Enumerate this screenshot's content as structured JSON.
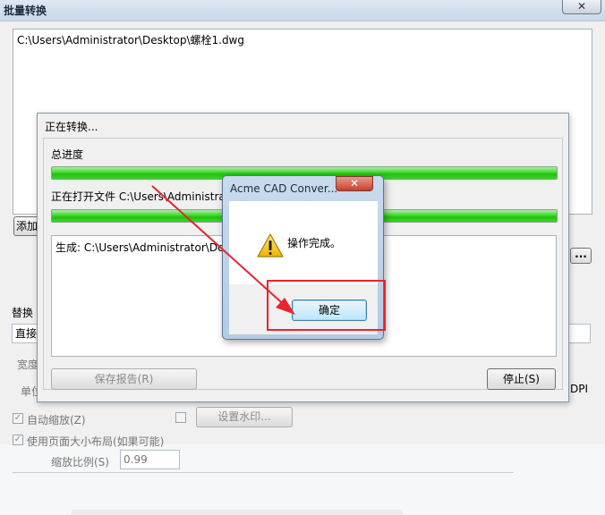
{
  "main": {
    "title": "批量转换",
    "close_glyph": "✕",
    "file_list": [
      "C:\\Users\\Administrator\\Desktop\\螺栓1.dwg"
    ],
    "add_button_partial": "添加",
    "browse_button": "...",
    "replace_label_partial": "替换",
    "direct_label_partial": "直接",
    "width_label_partial": "宽度",
    "unit_label_partial": "单位",
    "dpi_label": "DPI",
    "auto_zoom_label": "自动缩放(Z)",
    "watermark_button": "设置水印...",
    "use_page_layout_label": "使用页面大小布局(如果可能)",
    "zoom_ratio_label": "缩放比例(S)",
    "zoom_ratio_value": "0.99"
  },
  "progress": {
    "title": "正在转换...",
    "total_label": "总进度",
    "total_percent": 100,
    "opening_label": "正在打开文件 C:\\Users\\Administrato",
    "file_percent": 100,
    "log_line": "生成: C:\\Users\\Administrator\\Deskt",
    "save_report_button": "保存报告(R)",
    "stop_button": "停止(S)"
  },
  "message_box": {
    "title": "Acme CAD Conver...",
    "close_glyph": "✕",
    "icon": "warning-icon",
    "text": "操作完成。",
    "ok_button": "确定"
  },
  "annotation": {
    "color": "#e8242c"
  }
}
